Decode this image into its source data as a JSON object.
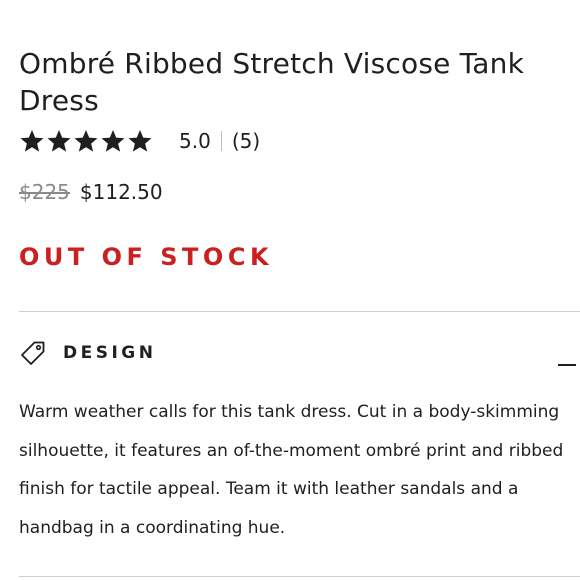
{
  "product": {
    "title": "Ombré Ribbed Stretch Viscose Tank Dress",
    "rating": {
      "stars_filled": 5,
      "stars_total": 5,
      "value_text": "5.0",
      "count_text": "(5)"
    },
    "price": {
      "original": "$225",
      "sale": "$112.50"
    },
    "stock_status": "OUT OF STOCK"
  },
  "design_section": {
    "title": "DESIGN",
    "expanded": true,
    "description": "Warm weather calls for this tank dress. Cut in a body-skimming silhouette, it features an of-the-moment ombré print and ribbed finish for tactile appeal. Team it with leather sandals and a handbag in a coordinating hue."
  },
  "colors": {
    "text": "#1f1f1f",
    "stock_red": "#cc1f1f",
    "muted_price": "#8a8a8a",
    "divider": "#cfcfcf"
  },
  "icons": {
    "star": "star-icon",
    "tag": "tag-icon",
    "collapse": "minus-icon"
  }
}
